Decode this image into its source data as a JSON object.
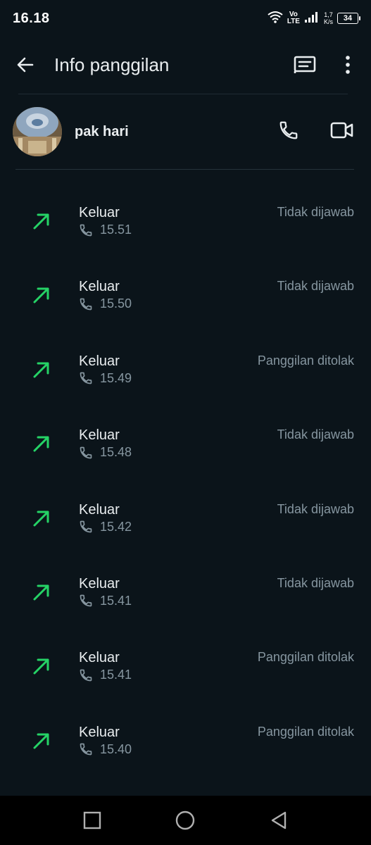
{
  "status_bar": {
    "time": "16.18",
    "volte_top": "Vo",
    "volte_bottom": "LTE",
    "speed_value": "1,7",
    "speed_unit": "K/s",
    "battery": "34"
  },
  "app_bar": {
    "title": "Info panggilan",
    "back_icon": "arrow-left-icon",
    "new_chat_icon": "chat-message-icon",
    "more_icon": "more-vertical-icon"
  },
  "contact": {
    "name": "pak hari",
    "call_icon": "phone-icon",
    "video_icon": "video-camera-icon"
  },
  "colors": {
    "background": "#0b141a",
    "outgoing_arrow": "#25d366",
    "secondary_text": "#8696a0"
  },
  "calls": [
    {
      "type": "Keluar",
      "time": "15.51",
      "status": "Tidak dijawab"
    },
    {
      "type": "Keluar",
      "time": "15.50",
      "status": "Tidak dijawab"
    },
    {
      "type": "Keluar",
      "time": "15.49",
      "status": "Panggilan ditolak"
    },
    {
      "type": "Keluar",
      "time": "15.48",
      "status": "Tidak dijawab"
    },
    {
      "type": "Keluar",
      "time": "15.42",
      "status": "Tidak dijawab"
    },
    {
      "type": "Keluar",
      "time": "15.41",
      "status": "Tidak dijawab"
    },
    {
      "type": "Keluar",
      "time": "15.41",
      "status": "Panggilan ditolak"
    },
    {
      "type": "Keluar",
      "time": "15.40",
      "status": "Panggilan ditolak"
    }
  ],
  "nav_bar": {
    "recents_icon": "square-recents-icon",
    "home_icon": "circle-home-icon",
    "back_icon": "triangle-back-icon"
  }
}
